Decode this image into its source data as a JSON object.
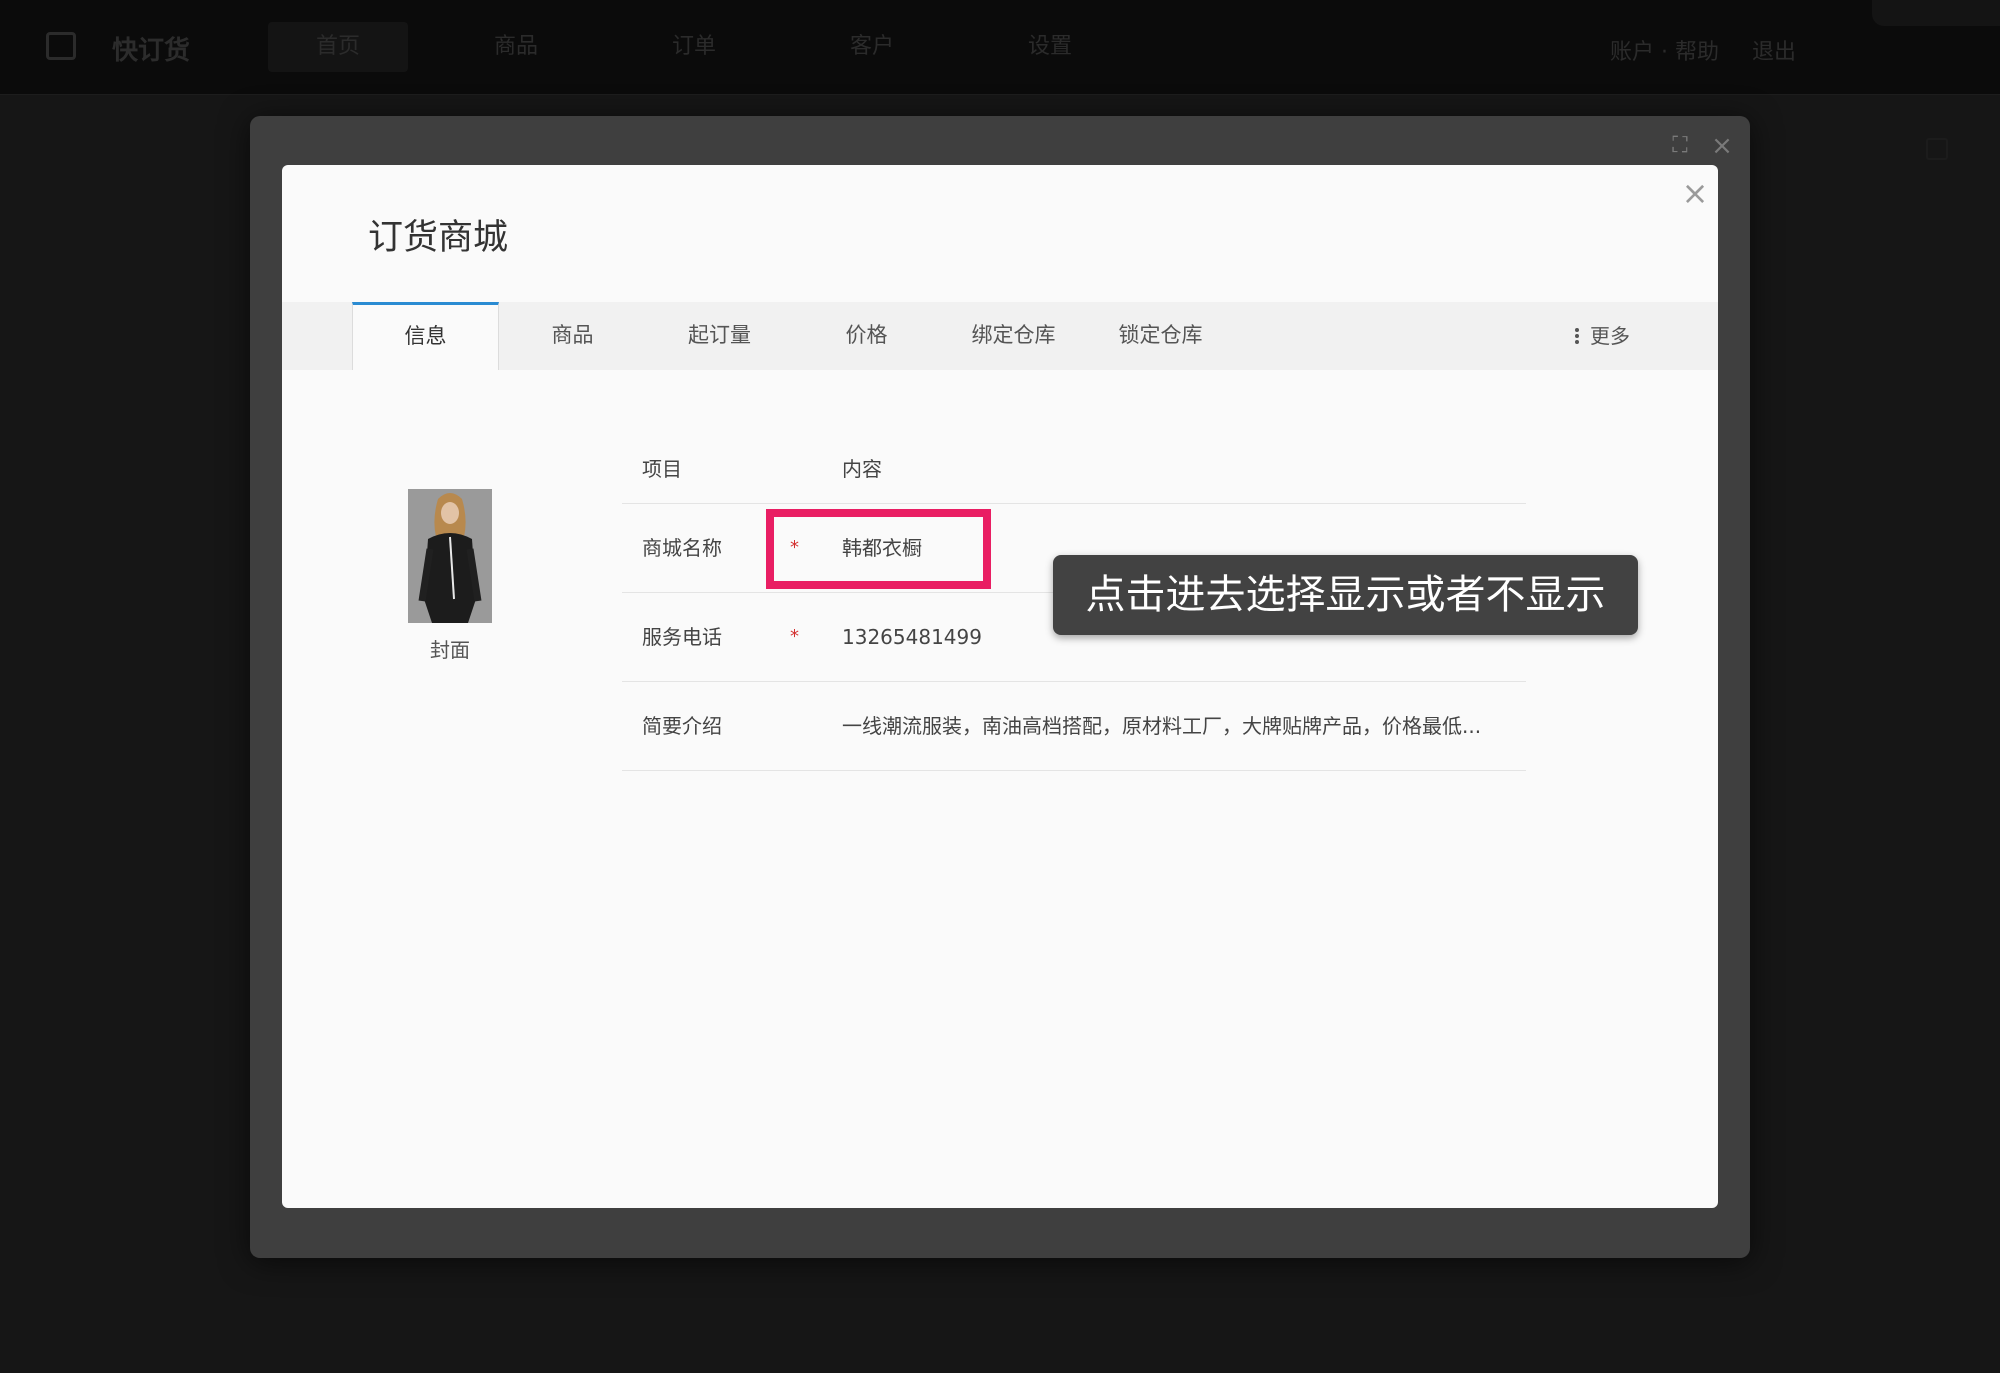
{
  "app": {
    "brand": "快订货",
    "nav": [
      "首页",
      "商品",
      "订单",
      "客户",
      "设置"
    ],
    "active_nav": 0,
    "user_link": "账户 · 帮助",
    "logout_link": "退出"
  },
  "dialog": {
    "title": "订货商城",
    "close_glyph": "×",
    "outer_close_glyph": "×",
    "expand_glyph": "⛶"
  },
  "tabs": [
    {
      "label": "信息",
      "active": true
    },
    {
      "label": "商品",
      "active": false
    },
    {
      "label": "起订量",
      "active": false
    },
    {
      "label": "价格",
      "active": false
    },
    {
      "label": "绑定仓库",
      "active": false
    },
    {
      "label": "锁定仓库",
      "active": false
    }
  ],
  "more_label": "更多",
  "cover": {
    "label": "封面",
    "icon": "cover-image"
  },
  "table": {
    "headers": {
      "item": "项目",
      "content": "内容"
    },
    "rows": [
      {
        "label": "商城名称",
        "required": "*",
        "value": "韩都衣橱"
      },
      {
        "label": "服务电话",
        "required": "*",
        "value": "13265481499"
      },
      {
        "label": "简要介绍",
        "required": "",
        "value": "一线潮流服装，南油高档搭配，原材料工厂，大牌贴牌产品，价格最低..."
      }
    ]
  },
  "tooltip": "点击进去选择显示或者不显示",
  "colors": {
    "accent": "#2a8bd2",
    "highlight": "#e91e63",
    "required": "#d32f2f",
    "tooltip_bg": "#424242"
  }
}
